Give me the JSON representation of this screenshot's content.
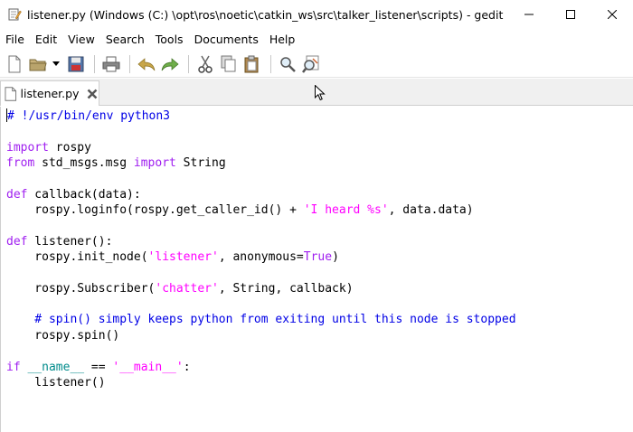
{
  "window": {
    "title": "listener.py (Windows (C:) \\opt\\ros\\noetic\\catkin_ws\\src\\talker_listener\\scripts) - gedit",
    "controls": [
      "minimize-icon",
      "maximize-icon",
      "close-icon"
    ]
  },
  "menu": {
    "items": [
      "File",
      "Edit",
      "View",
      "Search",
      "Tools",
      "Documents",
      "Help"
    ]
  },
  "toolbar": {
    "buttons": [
      "new-document-icon",
      "open-folder-icon",
      "open-dropdown-icon",
      "save-icon",
      "print-icon",
      "undo-icon",
      "redo-icon",
      "cut-icon",
      "copy-icon",
      "paste-icon",
      "find-icon",
      "find-replace-icon"
    ]
  },
  "tabs": [
    {
      "label": "listener.py",
      "icon": "document-icon",
      "close_icon": "close-icon"
    }
  ],
  "editor": {
    "language": "python",
    "lines": [
      [
        {
          "t": "# !/usr/bin/env python3",
          "c": "comment"
        }
      ],
      [
        {
          "t": "",
          "c": ""
        }
      ],
      [
        {
          "t": "import",
          "c": "kw"
        },
        {
          "t": " rospy",
          "c": ""
        }
      ],
      [
        {
          "t": "from",
          "c": "kw"
        },
        {
          "t": " std_msgs.msg ",
          "c": ""
        },
        {
          "t": "import",
          "c": "kw"
        },
        {
          "t": " String",
          "c": ""
        }
      ],
      [
        {
          "t": "",
          "c": ""
        }
      ],
      [
        {
          "t": "def",
          "c": "kw"
        },
        {
          "t": " callback(data):",
          "c": ""
        }
      ],
      [
        {
          "t": "    rospy.loginfo(rospy.get_caller_id() + ",
          "c": ""
        },
        {
          "t": "'I heard %s'",
          "c": "str"
        },
        {
          "t": ", data.data)",
          "c": ""
        }
      ],
      [
        {
          "t": "",
          "c": ""
        }
      ],
      [
        {
          "t": "def",
          "c": "kw"
        },
        {
          "t": " listener():",
          "c": ""
        }
      ],
      [
        {
          "t": "    rospy.init_node(",
          "c": ""
        },
        {
          "t": "'listener'",
          "c": "str"
        },
        {
          "t": ", anonymous=",
          "c": ""
        },
        {
          "t": "True",
          "c": "const"
        },
        {
          "t": ")",
          "c": ""
        }
      ],
      [
        {
          "t": "",
          "c": ""
        }
      ],
      [
        {
          "t": "    rospy.Subscriber(",
          "c": ""
        },
        {
          "t": "'chatter'",
          "c": "str"
        },
        {
          "t": ", String, callback)",
          "c": ""
        }
      ],
      [
        {
          "t": "",
          "c": ""
        }
      ],
      [
        {
          "t": "    # spin() simply keeps python from exiting until this node is stopped",
          "c": "comment"
        }
      ],
      [
        {
          "t": "    rospy.spin()",
          "c": ""
        }
      ],
      [
        {
          "t": "",
          "c": ""
        }
      ],
      [
        {
          "t": "if",
          "c": "kw"
        },
        {
          "t": " ",
          "c": ""
        },
        {
          "t": "__name__",
          "c": "builtin"
        },
        {
          "t": " == ",
          "c": ""
        },
        {
          "t": "'__main__'",
          "c": "str"
        },
        {
          "t": ":",
          "c": ""
        }
      ],
      [
        {
          "t": "    listener()",
          "c": ""
        }
      ]
    ]
  },
  "colors": {
    "comment": "#0000e6",
    "keyword": "#a020f0",
    "string": "#ff00ff",
    "builtin": "#008b8b"
  }
}
